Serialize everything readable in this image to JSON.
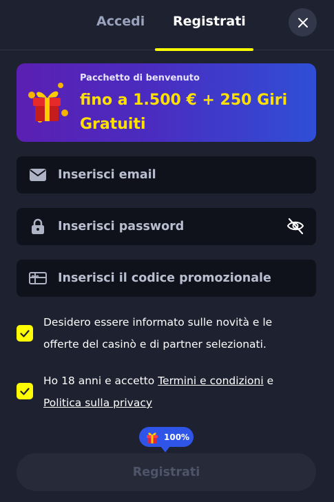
{
  "tabs": {
    "login_label": "Accedi",
    "register_label": "Registrati"
  },
  "banner": {
    "subtitle": "Pacchetto di benvenuto",
    "headline": "fino a 1.500 € + 250 Giri Gratuiti"
  },
  "form": {
    "email_placeholder": "Inserisci email",
    "password_placeholder": "Inserisci password",
    "promo_placeholder": "Inserisci il codice promozionale"
  },
  "consents": {
    "marketing_text": "Desidero essere informato sulle novità e le offerte del casinò e di partner selezionati.",
    "marketing_checked": true,
    "age_prefix": "Ho 18 anni e accetto ",
    "terms_link": "Termini e condizioni",
    "age_mid": " e ",
    "privacy_link": "Politica sulla privacy",
    "age_checked": true
  },
  "bonus_badge": {
    "label": "100%"
  },
  "submit_label": "Registrati",
  "icons": {
    "close": "close-icon",
    "email": "envelope-icon",
    "password": "lock-icon",
    "toggle_visibility": "eye-off-icon",
    "promo": "gift-card-icon",
    "check": "check-icon",
    "gift": "gift-icon"
  },
  "colors": {
    "background": "#1e2130",
    "accent": "#ffff00",
    "banner_headline": "#ffe100",
    "field_bg": "#10121b",
    "badge": "#2f55e8"
  }
}
